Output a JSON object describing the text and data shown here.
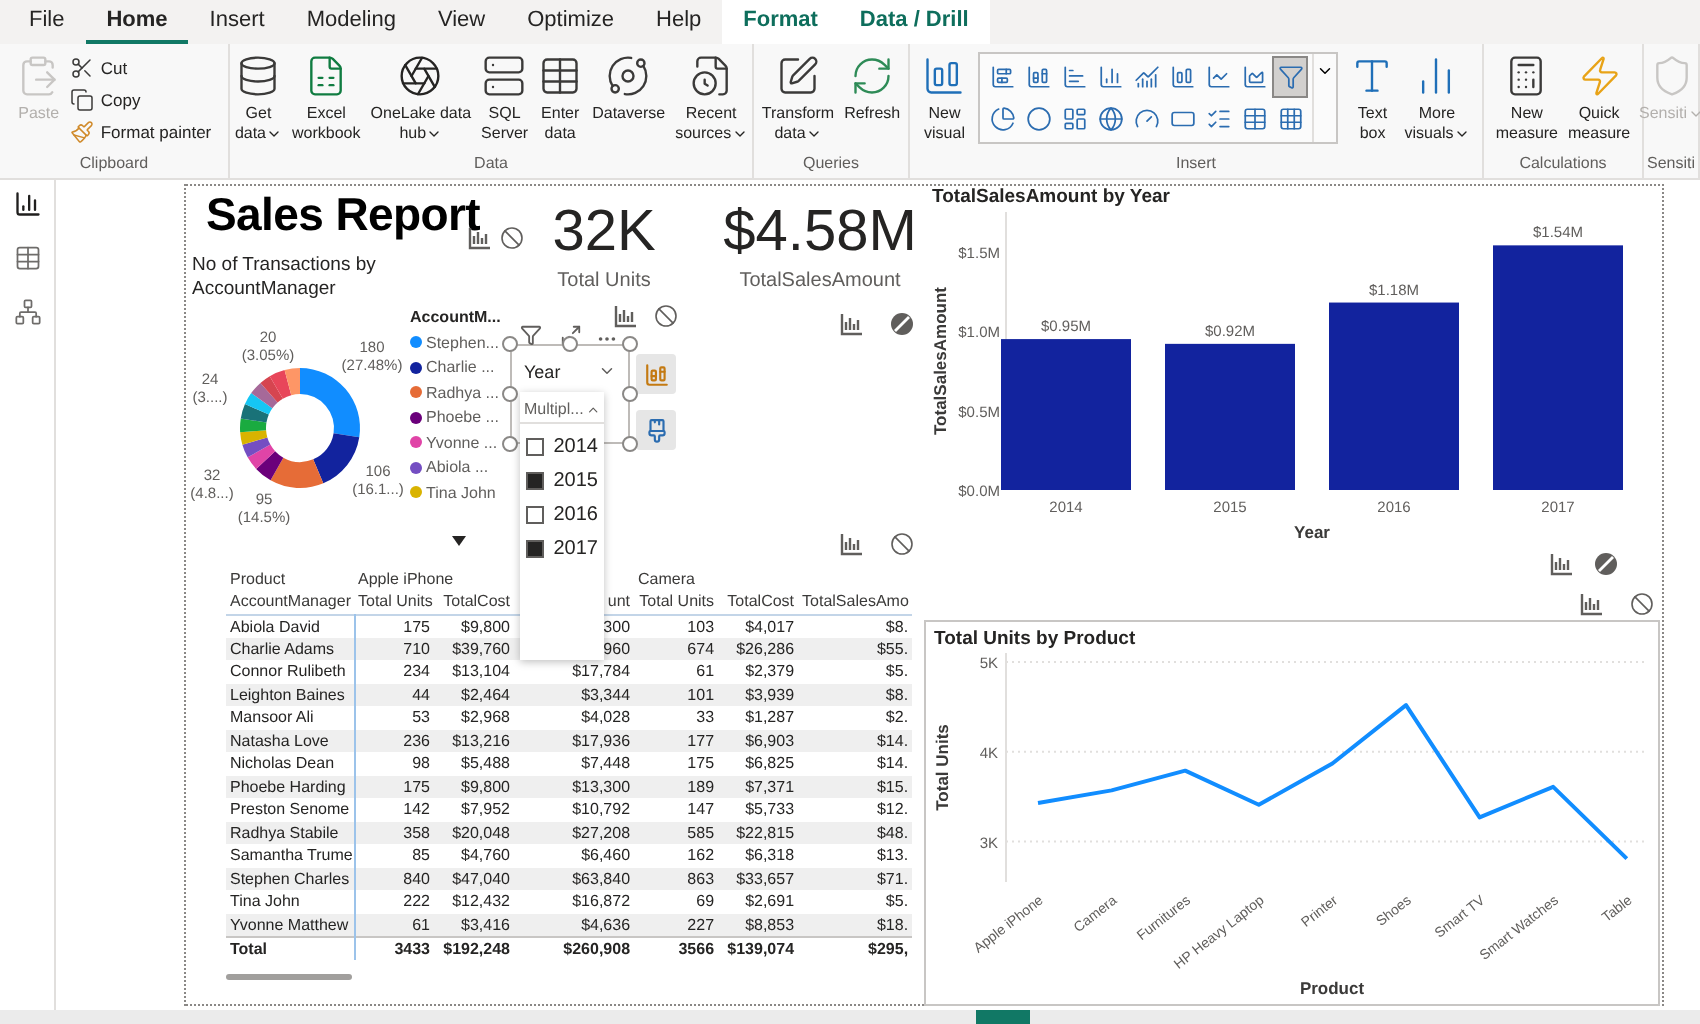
{
  "menu_tabs": [
    {
      "label": "File",
      "selected": false,
      "kind": "main"
    },
    {
      "label": "Home",
      "selected": true,
      "kind": "main"
    },
    {
      "label": "Insert",
      "selected": false,
      "kind": "main"
    },
    {
      "label": "Modeling",
      "selected": false,
      "kind": "main"
    },
    {
      "label": "View",
      "selected": false,
      "kind": "main"
    },
    {
      "label": "Optimize",
      "selected": false,
      "kind": "main"
    },
    {
      "label": "Help",
      "selected": false,
      "kind": "main"
    },
    {
      "label": "Format",
      "selected": false,
      "kind": "contextual"
    },
    {
      "label": "Data / Drill",
      "selected": false,
      "kind": "contextual"
    }
  ],
  "ribbon_groups": [
    {
      "label": "Clipboard",
      "items": [
        {
          "kind": "button",
          "lines": [
            "Paste"
          ],
          "dropdown": false,
          "disabled": true
        },
        {
          "kind": "stack",
          "items": [
            {
              "label": "Cut"
            },
            {
              "label": "Copy"
            },
            {
              "label": "Format painter"
            }
          ]
        }
      ]
    },
    {
      "label": "Data",
      "items": [
        {
          "kind": "button",
          "lines": [
            "Get",
            "data"
          ],
          "dropdown": true,
          "disabled": false
        },
        {
          "kind": "button",
          "lines": [
            "Excel",
            "workbook"
          ],
          "dropdown": false,
          "disabled": false
        },
        {
          "kind": "button",
          "lines": [
            "OneLake data",
            "hub"
          ],
          "dropdown": true,
          "disabled": false
        },
        {
          "kind": "button",
          "lines": [
            "SQL",
            "Server"
          ],
          "dropdown": false,
          "disabled": false
        },
        {
          "kind": "button",
          "lines": [
            "Enter",
            "data"
          ],
          "dropdown": false,
          "disabled": false
        },
        {
          "kind": "button",
          "lines": [
            "Dataverse"
          ],
          "dropdown": false,
          "disabled": false
        },
        {
          "kind": "button",
          "lines": [
            "Recent",
            "sources"
          ],
          "dropdown": true,
          "disabled": false
        }
      ]
    },
    {
      "label": "Queries",
      "items": [
        {
          "kind": "button",
          "lines": [
            "Transform",
            "data"
          ],
          "dropdown": true,
          "disabled": false
        },
        {
          "kind": "button",
          "lines": [
            "Refresh"
          ],
          "dropdown": false,
          "disabled": false
        }
      ]
    },
    {
      "label": "Insert",
      "items": [
        {
          "kind": "button",
          "lines": [
            "New",
            "visual"
          ],
          "dropdown": false,
          "disabled": false
        },
        {
          "kind": "gallery",
          "items": [
            {
              "selected": false
            },
            {
              "selected": false
            },
            {
              "selected": false
            },
            {
              "selected": false
            },
            {
              "selected": false
            },
            {
              "selected": false
            },
            {
              "selected": false
            },
            {
              "selected": false
            },
            {
              "selected": true
            },
            {
              "selected": false
            },
            {
              "selected": false
            },
            {
              "selected": false
            },
            {
              "selected": false
            },
            {
              "selected": false
            },
            {
              "selected": false
            },
            {
              "selected": false
            },
            {
              "selected": false
            },
            {
              "selected": false
            }
          ]
        },
        {
          "kind": "button",
          "lines": [
            "Text",
            "box"
          ],
          "dropdown": false,
          "disabled": false
        },
        {
          "kind": "button",
          "lines": [
            "More",
            "visuals"
          ],
          "dropdown": true,
          "disabled": false
        }
      ]
    },
    {
      "label": "Calculations",
      "items": [
        {
          "kind": "button",
          "lines": [
            "New",
            "measure"
          ],
          "dropdown": false,
          "disabled": false
        },
        {
          "kind": "button",
          "lines": [
            "Quick",
            "measure"
          ],
          "dropdown": false,
          "disabled": false
        }
      ]
    },
    {
      "label": "Sensiti",
      "items": [
        {
          "kind": "button",
          "lines": [
            "Sensiti"
          ],
          "dropdown": true,
          "disabled": true
        }
      ]
    }
  ],
  "views": [
    {
      "kind": "report",
      "selected": true
    },
    {
      "kind": "table",
      "selected": false
    },
    {
      "kind": "model",
      "selected": false
    }
  ],
  "report": {
    "title": "Sales Report",
    "cards": [
      {
        "value": "32K",
        "label": "Total Units"
      },
      {
        "value": "$4.58M",
        "label": "TotalSalesAmount"
      }
    ],
    "donut": {
      "title": "No of Transactions by AccountManager",
      "legend_title": "AccountM...",
      "legend": [
        {
          "label": "Stephen...",
          "color": "#118dff"
        },
        {
          "label": "Charlie ...",
          "color": "#12239e"
        },
        {
          "label": "Radhya ...",
          "color": "#e66c37"
        },
        {
          "label": "Phoebe ...",
          "color": "#6b007b"
        },
        {
          "label": "Yvonne ...",
          "color": "#e044a7"
        },
        {
          "label": "Abiola ...",
          "color": "#744ec2"
        },
        {
          "label": "Tina John",
          "color": "#d9b300"
        }
      ],
      "slices": [
        {
          "color": "#118dff"
        },
        {
          "color": "#12239e"
        },
        {
          "color": "#e66c37"
        },
        {
          "color": "#6b007b"
        },
        {
          "color": "#e044a7"
        },
        {
          "color": "#744ec2"
        },
        {
          "color": "#d9b300"
        },
        {
          "color": "#1aab40"
        },
        {
          "color": "#197278"
        },
        {
          "color": "#15c6f4"
        },
        {
          "color": "#a66999"
        },
        {
          "color": "#d64550"
        },
        {
          "color": "#e8465a"
        },
        {
          "color": "#fe9666"
        }
      ],
      "data_labels": [
        {
          "value": "180",
          "percent": "(27.48%)"
        },
        {
          "value": "106",
          "percent": "(16.1...)"
        },
        {
          "value": "95",
          "percent": "(14.5%)"
        },
        {
          "value": "32",
          "percent": "(4.8...)"
        },
        {
          "value": "24",
          "percent": "(3....)"
        },
        {
          "value": "20",
          "percent": "(3.05%)"
        }
      ],
      "chart_data": {
        "type": "donut",
        "values": [
          27.48,
          16.18,
          14.5,
          4.89,
          3.82,
          3.66,
          3.36,
          3.66,
          3.97,
          3.36,
          3.66,
          3.05,
          4.27,
          4.14
        ]
      }
    },
    "slicer": {
      "title": "Year",
      "mode": "Multipl...",
      "options": [
        {
          "label": "2014",
          "checked": false
        },
        {
          "label": "2015",
          "checked": true
        },
        {
          "label": "2016",
          "checked": false
        },
        {
          "label": "2017",
          "checked": true
        }
      ]
    },
    "matrix": {
      "group_row": [
        "Product",
        "Apple iPhone",
        "Camera"
      ],
      "columns": [
        "AccountManager",
        "Total Units",
        "TotalCost",
        "unt",
        "Total Units",
        "TotalCost",
        "TotalSalesAmo"
      ],
      "rows": [
        [
          "Abiola David",
          "175",
          "$9,800",
          "300",
          "103",
          "$4,017",
          "$8."
        ],
        [
          "Charlie Adams",
          "710",
          "$39,760",
          "960",
          "674",
          "$26,286",
          "$55."
        ],
        [
          "Connor Rulibeth",
          "234",
          "$13,104",
          "$17,784",
          "61",
          "$2,379",
          "$5."
        ],
        [
          "Leighton Baines",
          "44",
          "$2,464",
          "$3,344",
          "101",
          "$3,939",
          "$8."
        ],
        [
          "Mansoor Ali",
          "53",
          "$2,968",
          "$4,028",
          "33",
          "$1,287",
          "$2."
        ],
        [
          "Natasha Love",
          "236",
          "$13,216",
          "$17,936",
          "177",
          "$6,903",
          "$14."
        ],
        [
          "Nicholas Dean",
          "98",
          "$5,488",
          "$7,448",
          "175",
          "$6,825",
          "$14."
        ],
        [
          "Phoebe Harding",
          "175",
          "$9,800",
          "$13,300",
          "189",
          "$7,371",
          "$15."
        ],
        [
          "Preston Senome",
          "142",
          "$7,952",
          "$10,792",
          "147",
          "$5,733",
          "$12."
        ],
        [
          "Radhya Stabile",
          "358",
          "$20,048",
          "$27,208",
          "585",
          "$22,815",
          "$48."
        ],
        [
          "Samantha Trume",
          "85",
          "$4,760",
          "$6,460",
          "162",
          "$6,318",
          "$13."
        ],
        [
          "Stephen Charles",
          "840",
          "$47,040",
          "$63,840",
          "863",
          "$33,657",
          "$71."
        ],
        [
          "Tina John",
          "222",
          "$12,432",
          "$16,872",
          "69",
          "$2,691",
          "$5."
        ],
        [
          "Yvonne Matthew",
          "61",
          "$3,416",
          "$4,636",
          "227",
          "$8,853",
          "$18."
        ]
      ],
      "total": [
        "Total",
        "3433",
        "$192,248",
        "$260,908",
        "3566",
        "$139,074",
        "$295,"
      ]
    },
    "bar_chart": {
      "chart_data": {
        "type": "bar",
        "title": "TotalSalesAmount by Year",
        "xlabel": "Year",
        "ylabel": "TotalSalesAmount",
        "categories": [
          "2014",
          "2015",
          "2016",
          "2017"
        ],
        "series": [
          {
            "color": "#12239e",
            "values": [
              0.95,
              0.92,
              1.18,
              1.54
            ]
          }
        ],
        "ylim": [
          0,
          1.75
        ],
        "yticks": [
          {
            "value": 0,
            "label": "$0.0M"
          },
          {
            "value": 0.5,
            "label": "$0.5M"
          },
          {
            "value": 1,
            "label": "$1.0M"
          },
          {
            "value": 1.5,
            "label": "$1.5M"
          }
        ],
        "value_labels": [
          "$0.95M",
          "$0.92M",
          "$1.18M",
          "$1.54M"
        ]
      }
    },
    "line_chart": {
      "chart_data": {
        "type": "line",
        "title": "Total Units by Product",
        "xlabel": "Product",
        "ylabel": "Total Units",
        "categories": [
          "Apple iPhone",
          "Camera",
          "Furnitures",
          "HP Heavy Laptop",
          "Printer",
          "Shoes",
          "Smart TV",
          "Smart Watches",
          "Table"
        ],
        "series": [
          {
            "color": "#118dff",
            "values": [
              3430,
              3570,
              3790,
              3410,
              3870,
              4520,
              3270,
              3610,
              2810
            ]
          }
        ],
        "ylim": [
          2550,
          5100
        ],
        "yticks": [
          {
            "value": 3000,
            "label": "3K"
          },
          {
            "value": 4000,
            "label": "4K"
          },
          {
            "value": 5000,
            "label": "5K"
          }
        ],
        "grid": true
      }
    }
  }
}
